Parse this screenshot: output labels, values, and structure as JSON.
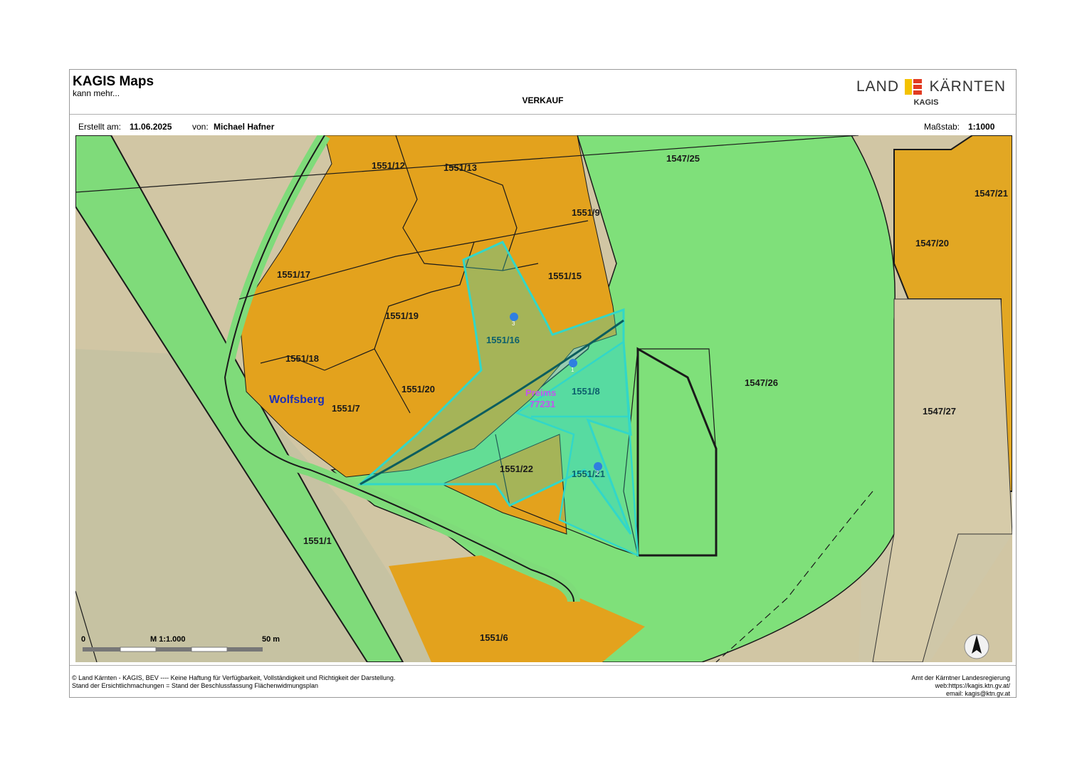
{
  "header": {
    "app_title": "KAGIS Maps",
    "app_subtitle": "kann mehr...",
    "document_title": "VERKAUF",
    "logo_text_left": "LAND",
    "logo_text_right": "KÄRNTEN",
    "logo_subtitle": "KAGIS"
  },
  "info": {
    "created_label": "Erstellt am:",
    "created_date": "11.06.2025",
    "author_label": "von:",
    "author_name": "Michael Hafner",
    "scale_label": "Maßstab:",
    "scale_value": "1:1000"
  },
  "map": {
    "municipality_label": "Wolfsberg",
    "cadastral_name": "Preims",
    "cadastral_number": "77231",
    "parcels": [
      "1551/12",
      "1551/13",
      "1547/25",
      "1551/9",
      "1547/21",
      "1547/20",
      "1551/17",
      "1551/15",
      "1551/19",
      "1551/16",
      "1551/18",
      "1547/26",
      "1551/8",
      "1551/20",
      "1551/7",
      "1547/27",
      "1551/22",
      "1551/21",
      "1551/1",
      "1551/6"
    ],
    "markers": [
      "1",
      "2",
      "3"
    ],
    "scale_bar": {
      "start": "0",
      "mid": "M 1:1.000",
      "end": "50 m"
    },
    "colors": {
      "building_zone": "#e3a21d",
      "green_zone": "#7fe07a",
      "selection": "#32d7c8",
      "boundary": "#1a1a1a",
      "marker": "#2f7fe0",
      "municipality_text": "#1c2fb8",
      "cadastral_text": "#c255ee"
    }
  },
  "footer": {
    "left_line1": "© Land Kärnten - KAGIS, BEV ---- Keine Haftung für Verfügbarkeit, Vollständigkeit und Richtigkeit der Darstellung.",
    "left_line2": "Stand der Ersichtlichmachungen = Stand der Beschlussfassung Flächenwidmungsplan",
    "right_line1": "Amt der Kärntner Landesregierung",
    "right_line2": "web:https://kagis.ktn.gv.at/",
    "right_line3": "email: kagis@ktn.gv.at"
  }
}
